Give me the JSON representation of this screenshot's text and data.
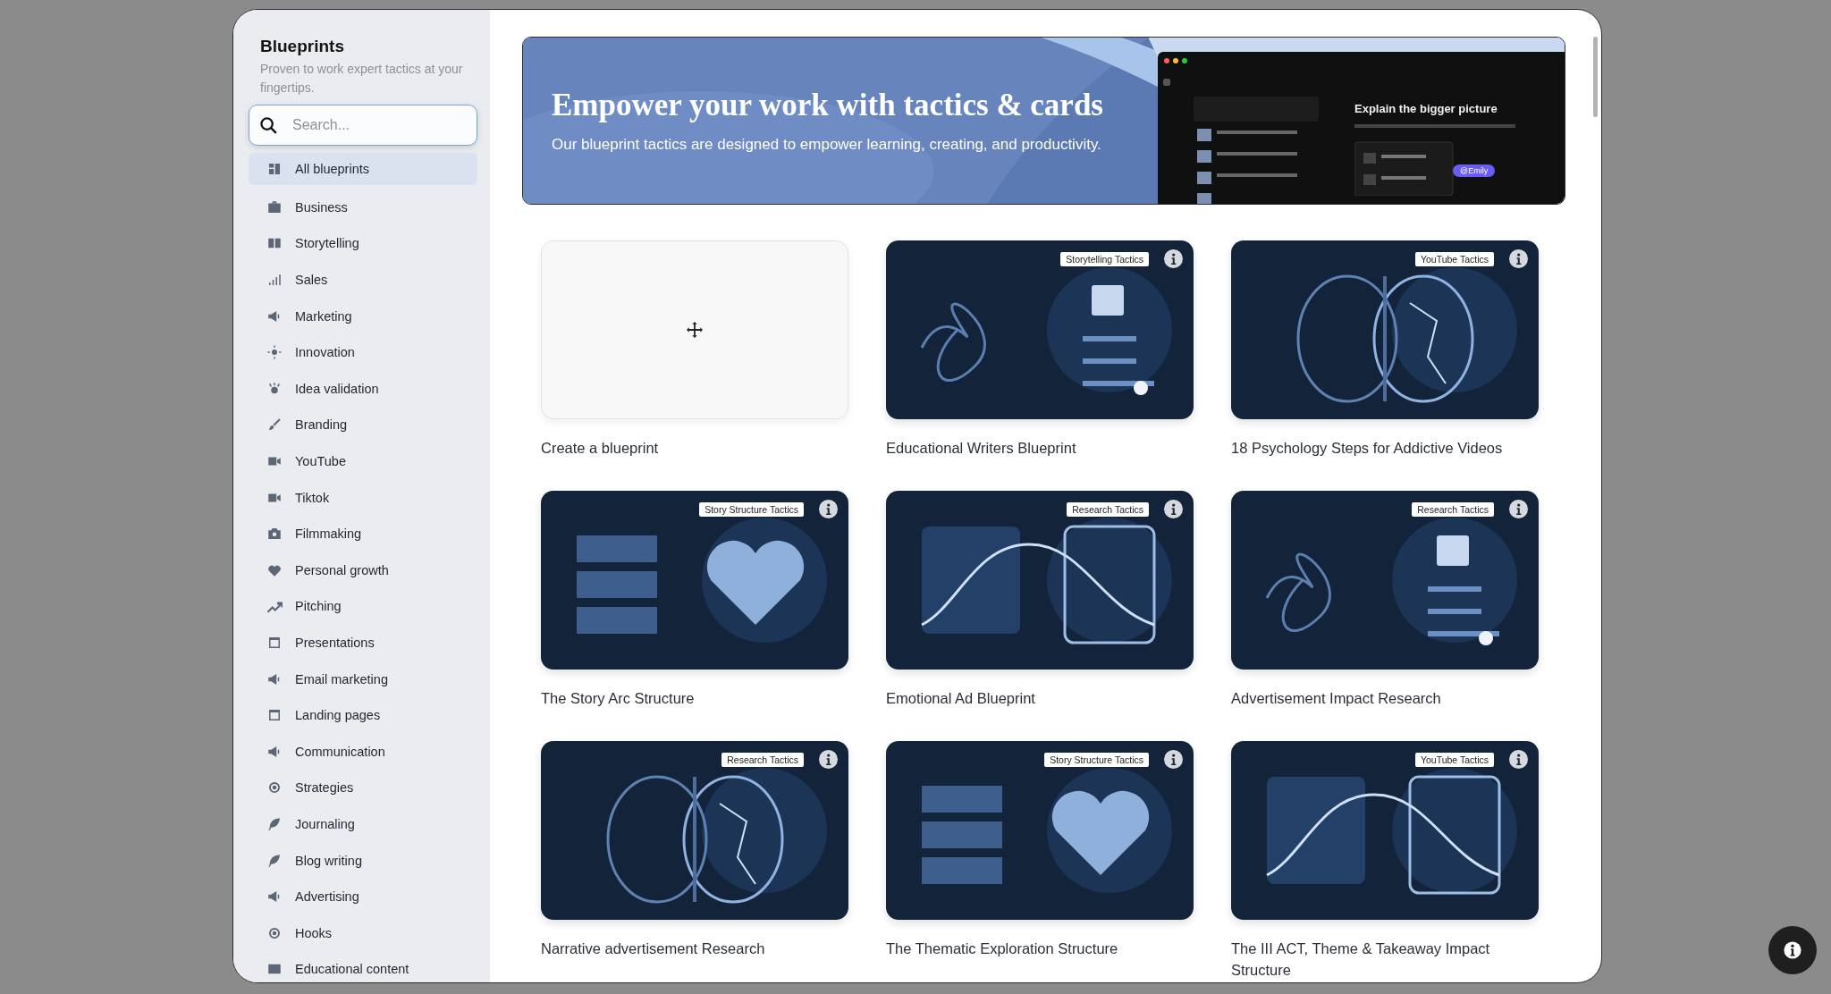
{
  "sidebar": {
    "title": "Blueprints",
    "subtitle": "Proven to work expert tactics at your fingertips.",
    "search": {
      "placeholder": "Search..."
    },
    "items": [
      {
        "label": "All blueprints",
        "selected": true
      },
      {
        "label": "Business",
        "selected": false
      },
      {
        "label": "Storytelling",
        "selected": false
      },
      {
        "label": "Sales",
        "selected": false
      },
      {
        "label": "Marketing",
        "selected": false
      },
      {
        "label": "Innovation",
        "selected": false
      },
      {
        "label": "Idea validation",
        "selected": false
      },
      {
        "label": "Branding",
        "selected": false
      },
      {
        "label": "YouTube",
        "selected": false
      },
      {
        "label": "Tiktok",
        "selected": false
      },
      {
        "label": "Filmmaking",
        "selected": false
      },
      {
        "label": "Personal growth",
        "selected": false
      },
      {
        "label": "Pitching",
        "selected": false
      },
      {
        "label": "Presentations",
        "selected": false
      },
      {
        "label": "Email marketing",
        "selected": false
      },
      {
        "label": "Landing pages",
        "selected": false
      },
      {
        "label": "Communication",
        "selected": false
      },
      {
        "label": "Strategies",
        "selected": false
      },
      {
        "label": "Journaling",
        "selected": false
      },
      {
        "label": "Blog writing",
        "selected": false
      },
      {
        "label": "Advertising",
        "selected": false
      },
      {
        "label": "Hooks",
        "selected": false
      },
      {
        "label": "Educational content",
        "selected": false
      }
    ]
  },
  "banner": {
    "heading": "Empower your work with tactics & cards",
    "text": "Our blueprint tactics are designed to empower learning, creating, and productivity.",
    "preview": {
      "heading": "Explain the bigger picture",
      "mention": "@Emily"
    }
  },
  "create_card": {
    "title": "Create a blueprint"
  },
  "cards": [
    {
      "kind": "picture",
      "title": "Educational Writers Blueprint",
      "tag": "Storytelling Tactics"
    },
    {
      "kind": "picture",
      "title": "18 Psychology Steps for Addictive Videos",
      "tag": "YouTube Tactics"
    },
    {
      "kind": "picture",
      "title": "The Story Arc Structure",
      "tag": "Story Structure Tactics"
    },
    {
      "kind": "picture",
      "title": "Emotional Ad Blueprint",
      "tag": "Research Tactics"
    },
    {
      "kind": "picture",
      "title": "Advertisement Impact Research",
      "tag": "Research Tactics"
    },
    {
      "kind": "picture",
      "title": "Narrative advertisement Research",
      "tag": "Research Tactics"
    },
    {
      "kind": "picture",
      "title": "The Thematic Exploration Structure",
      "tag": "Story Structure Tactics"
    },
    {
      "kind": "picture",
      "title": "The III ACT, Theme & Takeaway Impact Structure",
      "tag": "YouTube Tactics"
    }
  ]
}
